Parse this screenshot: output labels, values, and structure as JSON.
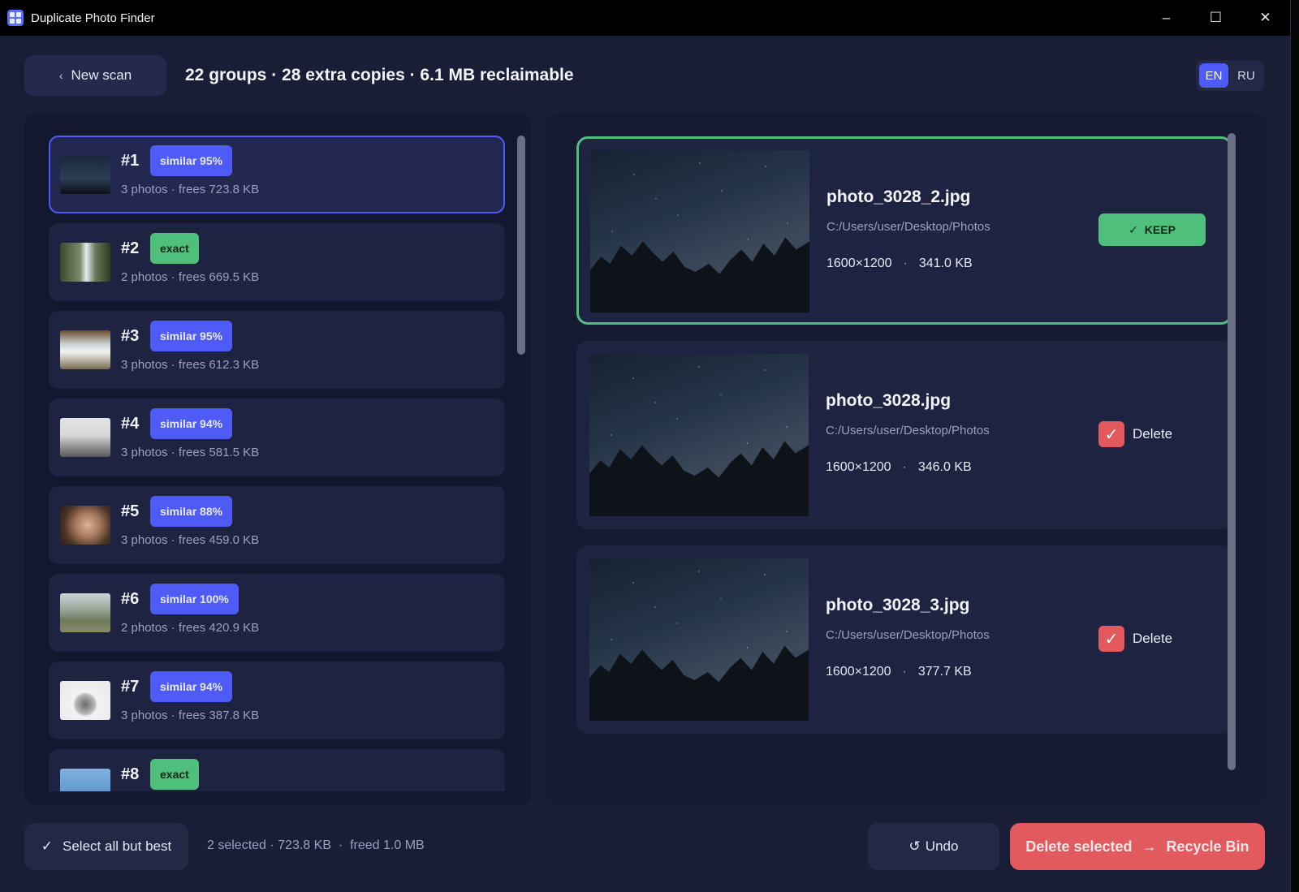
{
  "window": {
    "title": "Duplicate Photo Finder",
    "controls": {
      "minimize": "–",
      "maximize": "☐",
      "close": "✕"
    }
  },
  "header": {
    "new_scan_icon": "‹",
    "new_scan_label": "New scan",
    "summary": "22 groups · 28 extra copies · 6.1 MB reclaimable",
    "languages": [
      "EN",
      "RU"
    ],
    "active_language": "EN"
  },
  "groups": [
    {
      "num": "#1",
      "badge": "similar 95%",
      "badge_type": "similar",
      "meta": "3 photos · frees 723.8 KB",
      "selected": true
    },
    {
      "num": "#2",
      "badge": "exact",
      "badge_type": "exact",
      "meta": "2 photos · frees 669.5 KB",
      "selected": false
    },
    {
      "num": "#3",
      "badge": "similar 95%",
      "badge_type": "similar",
      "meta": "3 photos · frees 612.3 KB",
      "selected": false
    },
    {
      "num": "#4",
      "badge": "similar 94%",
      "badge_type": "similar",
      "meta": "3 photos · frees 581.5 KB",
      "selected": false
    },
    {
      "num": "#5",
      "badge": "similar 88%",
      "badge_type": "similar",
      "meta": "3 photos · frees 459.0 KB",
      "selected": false
    },
    {
      "num": "#6",
      "badge": "similar 100%",
      "badge_type": "similar",
      "meta": "2 photos · frees 420.9 KB",
      "selected": false
    },
    {
      "num": "#7",
      "badge": "similar 94%",
      "badge_type": "similar",
      "meta": "3 photos · frees 387.8 KB",
      "selected": false
    },
    {
      "num": "#8",
      "badge": "exact",
      "badge_type": "exact",
      "meta": "",
      "selected": false
    }
  ],
  "photos": [
    {
      "filename": "photo_3028_2.jpg",
      "path": "C:/Users/user/Desktop/Photos",
      "dimensions": "1600×1200",
      "size": "341.0 KB",
      "status": "keep"
    },
    {
      "filename": "photo_3028.jpg",
      "path": "C:/Users/user/Desktop/Photos",
      "dimensions": "1600×1200",
      "size": "346.0 KB",
      "status": "delete"
    },
    {
      "filename": "photo_3028_3.jpg",
      "path": "C:/Users/user/Desktop/Photos",
      "dimensions": "1600×1200",
      "size": "377.7 KB",
      "status": "delete"
    }
  ],
  "photo_actions": {
    "keep_icon": "✓",
    "keep_label": "KEEP",
    "delete_check": "✓",
    "delete_label": "Delete",
    "separator": "·"
  },
  "footer": {
    "select_all_icon": "✓",
    "select_all_label": "Select all but best",
    "status": "2 selected · 723.8 KB  ·  freed 1.0 MB",
    "undo_icon": "↺",
    "undo_label": "Undo",
    "delete_selected_label": "Delete selected",
    "delete_selected_arrow": "→",
    "delete_selected_target": "Recycle Bin"
  },
  "colors": {
    "accent": "#4e5bf6",
    "keep": "#4fc07b",
    "danger": "#e25a5e",
    "panel": "#1f2342"
  }
}
